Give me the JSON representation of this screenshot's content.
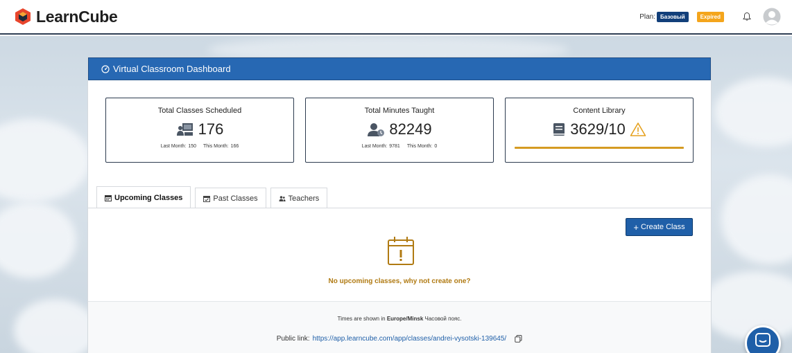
{
  "brand": {
    "name": "LearnCube"
  },
  "topbar": {
    "plan_label": "Plan:",
    "plan_badge": "Базовый",
    "expired_badge": "Expired",
    "icons": [
      "bell-icon",
      "avatar-icon"
    ]
  },
  "dashboard": {
    "title": "Virtual Classroom Dashboard",
    "stats": [
      {
        "title": "Total Classes Scheduled",
        "value": "176",
        "last_month_label": "Last Month:",
        "last_month_value": "150",
        "this_month_label": "This Month:",
        "this_month_value": "166",
        "icon": "classroom-icon"
      },
      {
        "title": "Total Minutes Taught",
        "value": "82249",
        "last_month_label": "Last Month:",
        "last_month_value": "9781",
        "this_month_label": "This Month:",
        "this_month_value": "0",
        "icon": "teacher-clock-icon"
      },
      {
        "title": "Content Library",
        "value": "3629/10",
        "icon": "book-icon",
        "warning_icon": "warning-icon"
      }
    ]
  },
  "tabs": [
    {
      "label": "Upcoming Classes",
      "icon": "calendar-icon",
      "active": true
    },
    {
      "label": "Past Classes",
      "icon": "calendar-check-icon",
      "active": false
    },
    {
      "label": "Teachers",
      "icon": "users-icon",
      "active": false
    }
  ],
  "actions": {
    "create_class": "Create Class"
  },
  "empty_state": {
    "icon": "calendar-alert-icon",
    "message": "No upcoming classes, why not create one?"
  },
  "footer": {
    "tz_prefix": "Times are shown in",
    "tz_name": "Europe/Minsk",
    "tz_suffix": "Часовой пояс.",
    "public_label": "Public link:",
    "public_url": "https://app.learncube.com/app/classes/andrei-vysotski-139645/"
  },
  "colors": {
    "header_blue": "#2768b3",
    "nav_border": "#2f3f55",
    "plan_badge": "#123f7a",
    "expired_badge": "#f4a51c",
    "empty_accent": "#b07a12",
    "library_bar": "#d59b22"
  }
}
